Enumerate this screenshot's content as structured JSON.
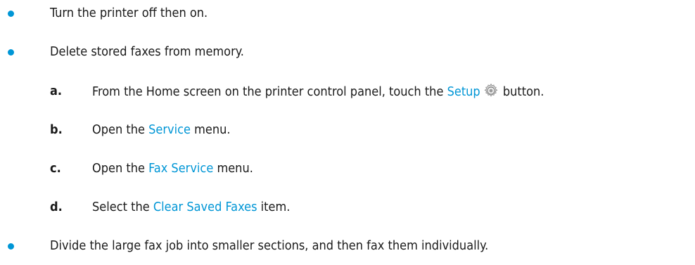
{
  "colors": {
    "accent": "#0096d6",
    "text": "#1a1a1a"
  },
  "items": [
    {
      "text": "Turn the printer off then on."
    },
    {
      "text": "Delete stored faxes from memory."
    },
    {
      "text": "Divide the large fax job into smaller sections, and then fax them individually."
    }
  ],
  "steps": [
    {
      "letter": "a.",
      "pre": "From the Home screen on the printer control panel, touch the ",
      "kw": "Setup",
      "icon": "gear-icon",
      "post": " button."
    },
    {
      "letter": "b.",
      "pre": "Open the ",
      "kw": "Service",
      "post": " menu."
    },
    {
      "letter": "c.",
      "pre": "Open the ",
      "kw": "Fax Service",
      "post": " menu."
    },
    {
      "letter": "d.",
      "pre": "Select the ",
      "kw": "Clear Saved Faxes",
      "post": " item."
    }
  ]
}
